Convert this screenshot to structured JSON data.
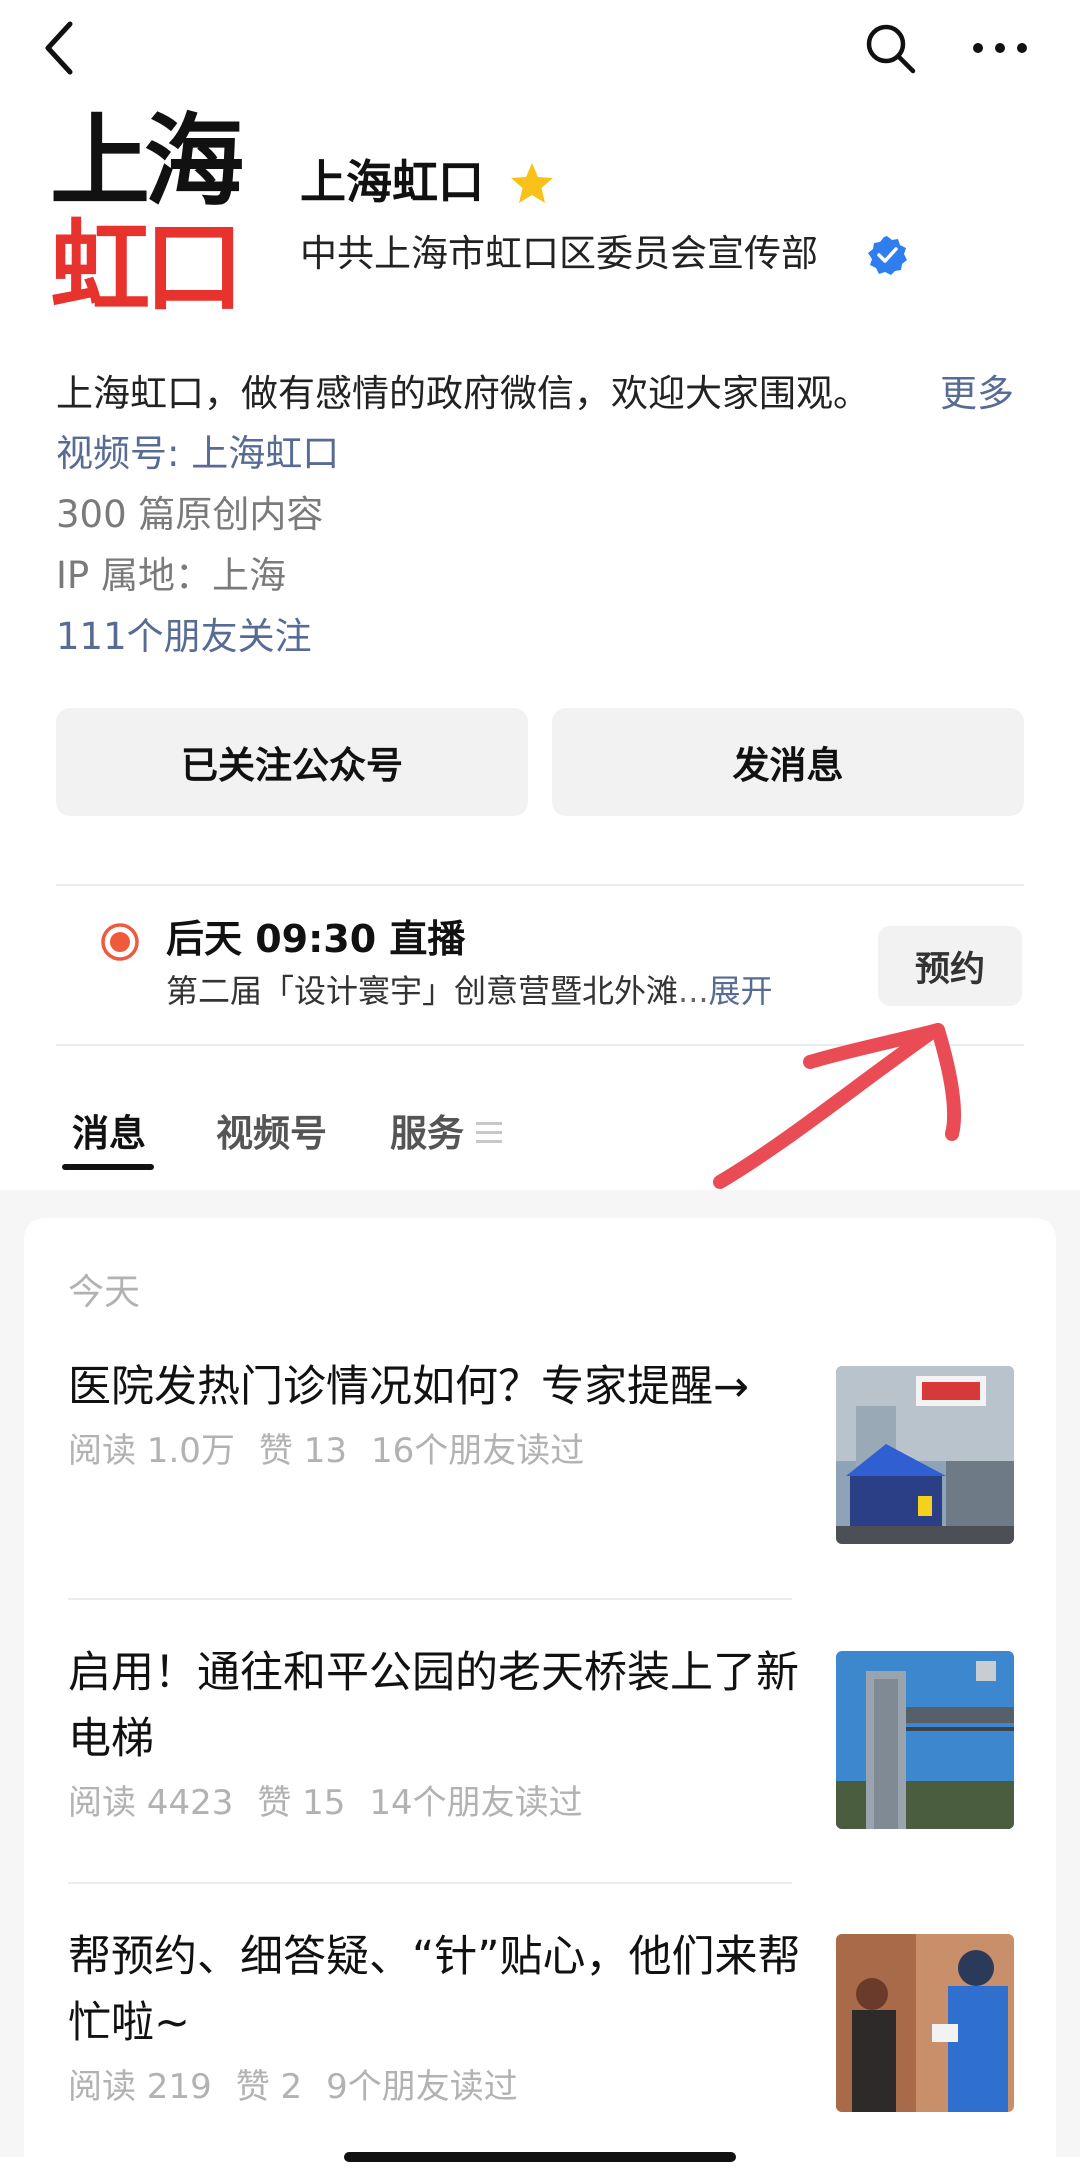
{
  "nav": {
    "back_icon": "chevron-left-icon",
    "search_icon": "search-icon",
    "more_icon": "more-dots-icon"
  },
  "account": {
    "logo_line1": "上海",
    "logo_line2": "虹口",
    "name": "上海虹口",
    "org": "中共上海市虹口区委员会宣传部",
    "description": "上海虹口，做有感情的政府微信，欢迎大家围观。",
    "more_label": "更多",
    "channels": "视频号: 上海虹口",
    "original_count": "300 篇原创内容",
    "ip_location": "IP 属地：上海",
    "friends_following": "111个朋友关注"
  },
  "buttons": {
    "followed": "已关注公众号",
    "message": "发消息"
  },
  "live": {
    "title": "后天 09:30 直播",
    "subtitle": "第二届「设计寰宇」创意营暨北外滩",
    "ellipsis": "...",
    "expand": "展开",
    "reserve": "预约"
  },
  "tabs": [
    "消息",
    "视频号",
    "服务"
  ],
  "feed": {
    "section": "今天",
    "articles": [
      {
        "title": "医院发热门诊情况如何？专家提醒→",
        "reads": "阅读 1.0万",
        "likes": "赞 13",
        "friends": "16个朋友读过"
      },
      {
        "title": "启用！通往和平公园的老天桥装上了新电梯",
        "reads": "阅读 4423",
        "likes": "赞 15",
        "friends": "14个朋友读过"
      },
      {
        "title": "帮预约、细答疑、“针”贴心，他们来帮忙啦~",
        "reads": "阅读 219",
        "likes": "赞 2",
        "friends": "9个朋友读过"
      }
    ]
  },
  "colors": {
    "link": "#576b95",
    "logo_red": "#e8322e",
    "live_red": "#f05a3c",
    "verified_blue": "#2f7ef0",
    "arrow_red": "#e94c54"
  }
}
